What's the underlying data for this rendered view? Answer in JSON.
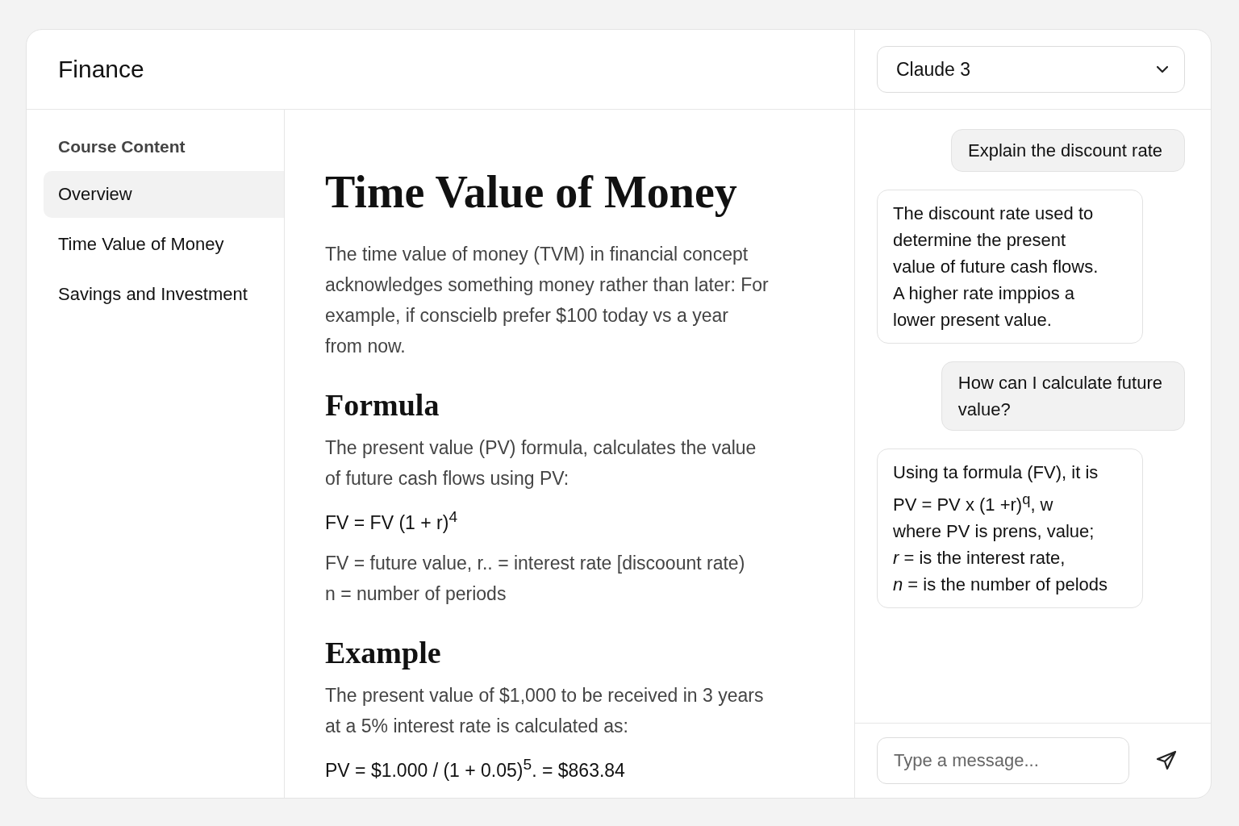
{
  "app": {
    "title": "Finance"
  },
  "model_select": {
    "value": "Claude 3"
  },
  "sidebar": {
    "heading": "Course Content",
    "items": [
      {
        "label": "Overview",
        "selected": true
      },
      {
        "label": "Time Value of Money",
        "selected": false
      },
      {
        "label": "Savings and Investment",
        "selected": false
      }
    ]
  },
  "article": {
    "title": "Time Value of Money",
    "blocks": [
      {
        "kind": "paragraph",
        "text": "The time value of money (TVM) in financial concept\nacknowledges something money rather than later: For\nexample, if conscielb prefer $100 today vs a year\nfrom now."
      },
      {
        "kind": "heading",
        "text": "Formula"
      },
      {
        "kind": "paragraph",
        "text": "The present value (PV) formula, calculates the value\nof future cash flows using PV:"
      },
      {
        "kind": "formula",
        "text": "FV = FV (1 + r)$^{4}$"
      },
      {
        "kind": "paragraph",
        "text": "FV = future value, r.. = interest rate  [discoount rate)\nn = number of periods"
      },
      {
        "kind": "heading",
        "text": "Example"
      },
      {
        "kind": "paragraph",
        "text": "The present value of $1,000 to be received in 3 years\nat a 5% interest rate is calculated as:"
      },
      {
        "kind": "formula",
        "text": "PV = $1.000 / (1 + 0.05)$^{5}$.  = $863.84"
      }
    ]
  },
  "chat": {
    "messages": [
      {
        "kind": "user",
        "text": "Explain the discount rate"
      },
      {
        "kind": "assistant",
        "text": "The discount rate used to\ndetermine the present\nvalue of future cash flows.\nA higher rate imppios a\nlower present value."
      },
      {
        "kind": "user",
        "text": "How can I calculate future\nvalue?"
      },
      {
        "kind": "assistant",
        "text": "Using ta formula (FV), it is\nPV = PV x (1 +r)$^{q}$, w\nwhere PV is prens, value;\n*r* = is the interest rate,\n*n* = is the number of pelods"
      }
    ],
    "input": {
      "placeholder": "Type a message..."
    }
  }
}
